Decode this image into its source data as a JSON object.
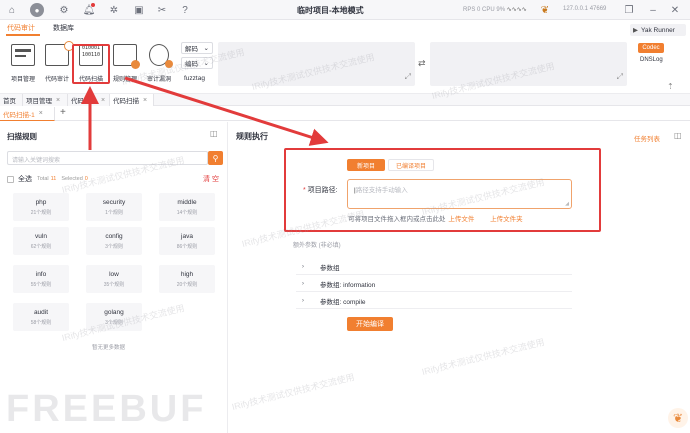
{
  "window": {
    "title": "临时项目-本地模式",
    "rps": "RPS 0",
    "cpu": "CPU 9%",
    "ip": "127.0.0.1",
    "port": "47669"
  },
  "top_icons": [
    "home-icon",
    "user-icon",
    "settings-icon",
    "bell-icon",
    "bug-icon",
    "terminal-icon",
    "tools-icon",
    "help-icon"
  ],
  "menu": {
    "tabs": [
      "代码审计",
      "数据库"
    ]
  },
  "toolbar": {
    "tools": [
      "项目管理",
      "代码审计",
      "代码扫描",
      "规则管理",
      "审计漏洞"
    ],
    "dropdowns": [
      "解码",
      "编码"
    ],
    "fuzztag": "fuzztag",
    "yak_runner": "Yak Runner",
    "codec": "Codec",
    "dnslog": "DNSLog"
  },
  "page_tabs": [
    {
      "label": "首页"
    },
    {
      "label": "项目管理"
    },
    {
      "label": "代码审计"
    },
    {
      "label": "代码扫描"
    }
  ],
  "sub_tabs": [
    {
      "label": "代码扫描-1"
    }
  ],
  "left": {
    "title": "扫描规则",
    "search_placeholder": "请输入关键词搜索",
    "select_all": "全选",
    "total_label": "Total",
    "total": "11",
    "selected_label": "Selected",
    "selected": "0",
    "clear": "清 空",
    "rules": [
      {
        "name": "php",
        "count": "21个规则"
      },
      {
        "name": "security",
        "count": "1个规则"
      },
      {
        "name": "middle",
        "count": "14个规则"
      },
      {
        "name": "vuln",
        "count": "62个规则"
      },
      {
        "name": "config",
        "count": "3个规则"
      },
      {
        "name": "java",
        "count": "86个规则"
      },
      {
        "name": "info",
        "count": "55个规则"
      },
      {
        "name": "low",
        "count": "35个规则"
      },
      {
        "name": "high",
        "count": "20个规则"
      },
      {
        "name": "audit",
        "count": "58个规则"
      },
      {
        "name": "golang",
        "count": "3个规则"
      }
    ],
    "no_more": "暂无更多数据"
  },
  "right": {
    "title": "规则执行",
    "task_list": "任务列表",
    "seg_new": "新项目",
    "seg_compiled": "已编译项目",
    "path_label": "项目路径:",
    "path_placeholder": "路径支持手动输入",
    "hint": "可将项目文件拖入框内或点击此处",
    "upload_file": "上传文件",
    "upload_folder": "上传文件夹",
    "extra_label": "额外参数 (非必填)",
    "groups": [
      "参数组",
      "参数组: information",
      "参数组: compile"
    ],
    "compile_btn": "开始编译"
  },
  "watermarks": {
    "text": "IRify技术测试仅供技术交流使用",
    "brand": "FREEBUF"
  },
  "colors": {
    "accent": "#f17f30",
    "annotation_red": "#e23b3b"
  }
}
